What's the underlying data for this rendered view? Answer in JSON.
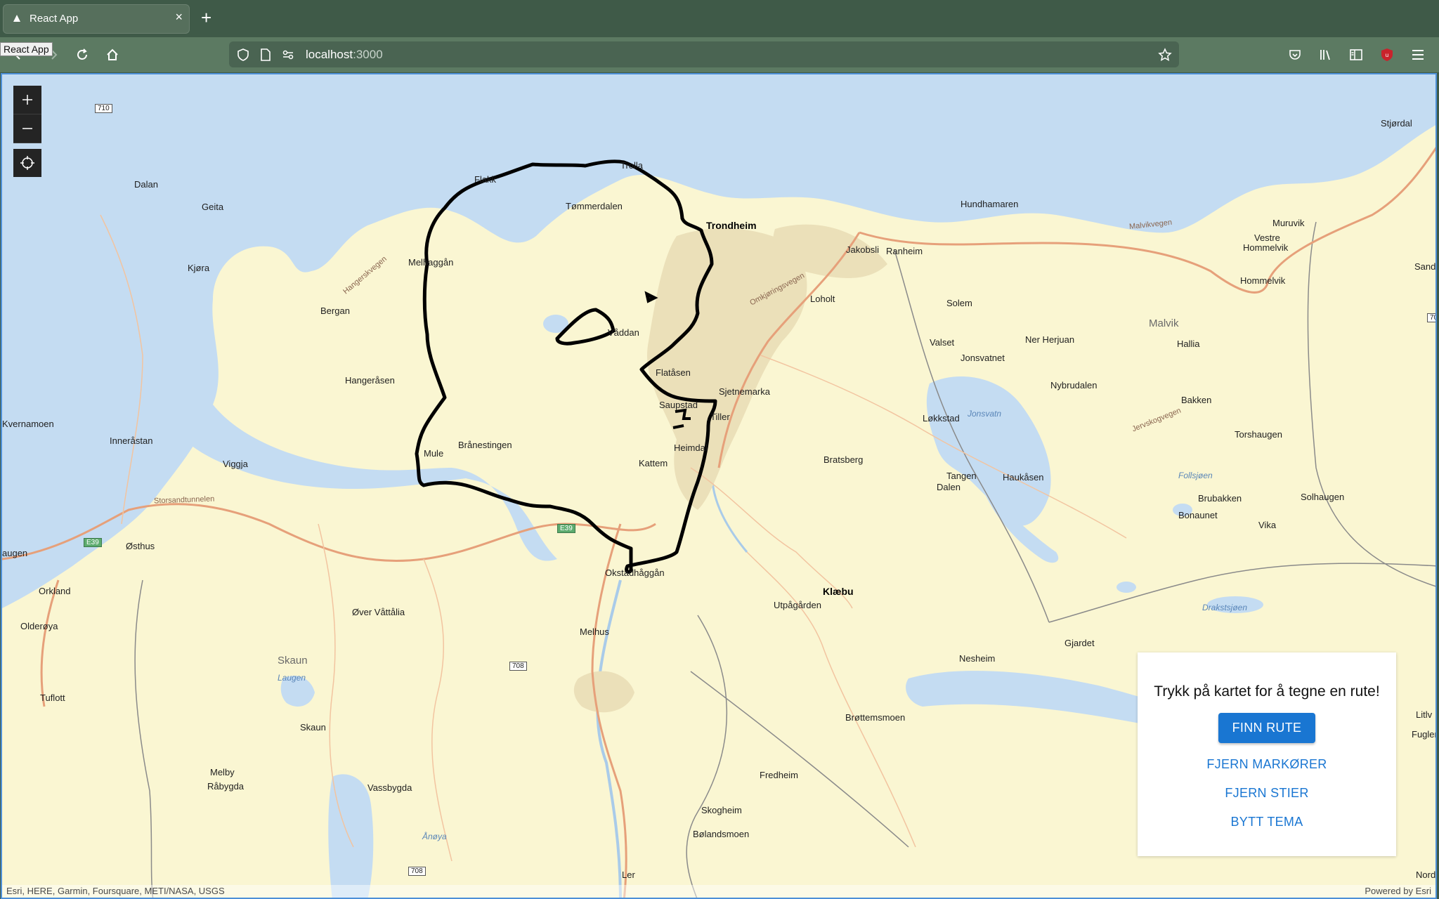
{
  "browser": {
    "tab_title": "React App",
    "tooltip": "React App",
    "url_host": "localhost",
    "url_port": ":3000"
  },
  "map": {
    "labels": {
      "stjordal": "Stjørdal",
      "dalan": "Dalan",
      "geita": "Geita",
      "kjora": "Kjøra",
      "flakk": "Flakk",
      "trolla": "Trolla",
      "tommerdalen": "Tømmerdalen",
      "trondheim": "Trondheim",
      "melhaggan": "Melhaggån",
      "bergan": "Bergan",
      "vaddan": "Våddan",
      "hangerasen": "Hangeråsen",
      "flatasen": "Flatåsen",
      "saupstad": "Saupstad",
      "sjetnemarka": "Sjetnemarka",
      "tiller": "Tiller",
      "kvernamoen": "Kvernamoen",
      "innerastan": "Inneråstan",
      "branestingen": "Brånestingen",
      "mule": "Mule",
      "heimdal": "Heimdal",
      "kattem": "Kattem",
      "viggja": "Viggja",
      "hundhamaren": "Hundhamaren",
      "muruvik": "Muruvik",
      "vestre_hommelvik": "Vestre",
      "vestre_hommelvik2": "Hommelvik",
      "jakobsli": "Jakobsli",
      "ranheim": "Ranheim",
      "hommelvik": "Hommelvik",
      "sand": "Sand",
      "solem": "Solem",
      "loholt": "Loholt",
      "malvik": "Malvik",
      "valset": "Valset",
      "ner_herjuan": "Ner Herjuan",
      "jonsvatnet": "Jonsvatnet",
      "hallia": "Hallia",
      "nybrudalen": "Nybrudalen",
      "bakken": "Bakken",
      "lokkstad": "Løkkstad",
      "torshaugen": "Torshaugen",
      "bratsberg": "Bratsberg",
      "tangen": "Tangen",
      "dalen": "Dalen",
      "haukasen": "Haukåsen",
      "brubakken": "Brubakken",
      "solhaugen": "Solhaugen",
      "bonaunet": "Bonaunet",
      "vika": "Vika",
      "ostshus": "Østhus",
      "augen": "augen",
      "orkland": "Orkland",
      "olderoya": "Olderøya",
      "over_vattalia": "Øver Våttålia",
      "okstadhaggan": "Okstadhåggån",
      "klaebu": "Klæbu",
      "utpagarden": "Utpågården",
      "melhus": "Melhus",
      "skaun_region": "Skaun",
      "tuflott": "Tuflott",
      "skaun": "Skaun",
      "gjardet": "Gjardet",
      "nesheim": "Nesheim",
      "brottemsmoen": "Brøttemsmoen",
      "melby": "Melby",
      "rabygda": "Råbygda",
      "vassbygda": "Vassbygda",
      "fredheim": "Fredheim",
      "skogheim": "Skogheim",
      "bolandsmoen": "Bølandsmoen",
      "ler": "Ler",
      "litlv": "Litlv",
      "fugler": "Fugler",
      "nord": "Nord"
    },
    "water_labels": {
      "jonsvatn": "Jonsvatn",
      "follsjoen": "Follsjøen",
      "drakstsjoen": "Drakstsjøen",
      "laugen": "Laugen",
      "amoya": "Ånøya"
    },
    "road_labels": {
      "omkjoringsvegen": "Omkjøringsvegen",
      "storsandtunnelen": "Storsandtunnelen",
      "malvikvegen": "Malvikvegen",
      "jervskogvegen": "Jervskogvegen",
      "hangerskvegen": "Hangerskvegen"
    },
    "shields": {
      "r710": "710",
      "r708a": "708",
      "r708b": "708",
      "r708c": "708",
      "r70": "70",
      "e39a": "E39",
      "e39b": "E39"
    },
    "attribution_left": "Esri, HERE, Garmin, Foursquare, METI/NASA, USGS",
    "attribution_right": "Powered by Esri"
  },
  "panel": {
    "title": "Trykk på kartet for å tegne en rute!",
    "find_route": "FINN RUTE",
    "remove_markers": "FJERN MARKØRER",
    "remove_paths": "FJERN STIER",
    "switch_theme": "BYTT TEMA"
  }
}
